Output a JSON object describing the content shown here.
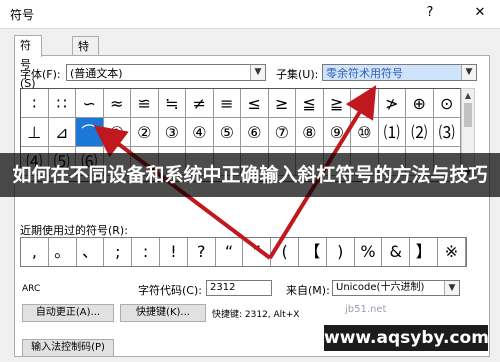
{
  "window": {
    "title": "符号",
    "help_label": "?",
    "close_label": "✕"
  },
  "tabs": [
    {
      "label": "符号(S)"
    },
    {
      "label": "特殊字符(P)"
    }
  ],
  "font": {
    "label": "字体(F):",
    "value": "(普通文本)"
  },
  "subset": {
    "label": "子集(U):",
    "value": "零余符术用符号"
  },
  "grid": {
    "rows": [
      [
        "∶",
        "∷",
        "∽",
        "≈",
        "≌",
        "≒",
        "≠",
        "≡",
        "≤",
        "≥",
        "≦",
        "≧",
        "≮",
        "≯",
        "⊕",
        "⊙"
      ],
      [
        "⊥",
        "⊿",
        "⌒",
        "①",
        "②",
        "③",
        "④",
        "⑤",
        "⑥",
        "⑦",
        "⑧",
        "⑨",
        "⑩",
        "⑴",
        "⑵",
        "⑶"
      ],
      [
        "⑷",
        "⑸",
        "⑹",
        "",
        "",
        "",
        "",
        "",
        "",
        "",
        "",
        "",
        "",
        "",
        "",
        ""
      ]
    ],
    "selected": {
      "row": 1,
      "col": 2
    }
  },
  "recent": {
    "label": "近期使用过的符号(R):",
    "symbols": [
      ",",
      "。",
      "、",
      ";",
      ":",
      "!",
      "?",
      "“",
      "”",
      "(",
      "【",
      ")",
      "%",
      "&",
      "】",
      "※"
    ]
  },
  "bottom": {
    "unicode_name": "ARC",
    "code_label": "字符代码(C):",
    "code_value": "2312",
    "from_label": "来自(M):",
    "from_value": "Unicode(十六进制)",
    "autocorrect_label": "自动更正(A)...",
    "shortcut_label": "快捷键(K)...",
    "shortcut_text": "快捷键: 2312, Alt+X",
    "ime_label": "输入法控制码(P)"
  },
  "banner": {
    "text": "如何在不同设备和系统中正确输入斜杠符号的方法与技巧"
  },
  "watermark": {
    "text": "www.aqsyby.com",
    "sub": "jb51.net"
  },
  "colors": {
    "selected": "#1b78d6",
    "arrow": "#c0181e",
    "subset_highlight": "#cfe4fb"
  }
}
